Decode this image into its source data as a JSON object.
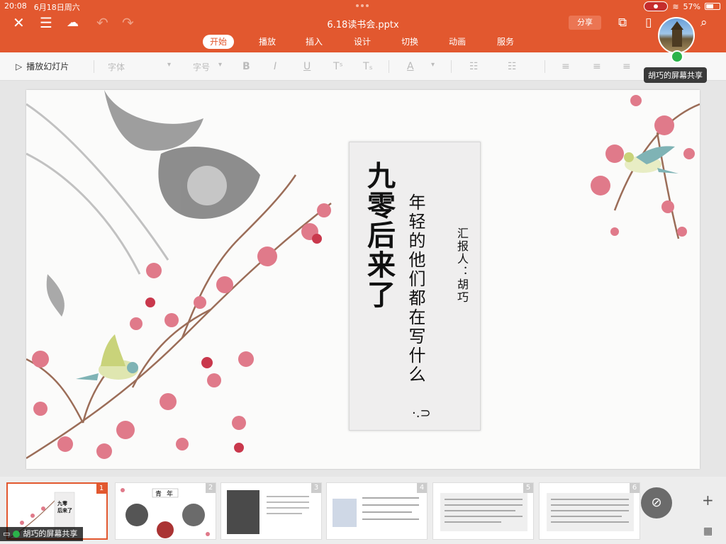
{
  "status_bar": {
    "time": "20:08",
    "date": "6月18日周六",
    "battery": "57%",
    "battery_level": 0.57
  },
  "app": {
    "filename": "6.18读书会.pptx",
    "share_label": "分享"
  },
  "tabs": [
    {
      "label": "开始",
      "active": true
    },
    {
      "label": "播放"
    },
    {
      "label": "插入"
    },
    {
      "label": "设计"
    },
    {
      "label": "切换"
    },
    {
      "label": "动画"
    },
    {
      "label": "服务"
    }
  ],
  "toolbar": {
    "play_label": "播放幻灯片",
    "font_placeholder": "字体",
    "size_placeholder": "字号"
  },
  "screen_share": {
    "label": "胡巧的屏幕共享"
  },
  "slide": {
    "main_title": "九零后来了",
    "subtitle": "年轻的他们都在写什么",
    "reporter": "汇报人：胡巧",
    "glyph": "·.⊃"
  },
  "thumbnails": [
    {
      "num": "1",
      "active": true
    },
    {
      "num": "2",
      "texts": [
        "青",
        "年"
      ]
    },
    {
      "num": "3"
    },
    {
      "num": "4"
    },
    {
      "num": "5"
    },
    {
      "num": "6"
    }
  ],
  "colors": {
    "accent": "#e2582f",
    "blossom": "#e07a8a",
    "bird": "#c9d37a"
  }
}
